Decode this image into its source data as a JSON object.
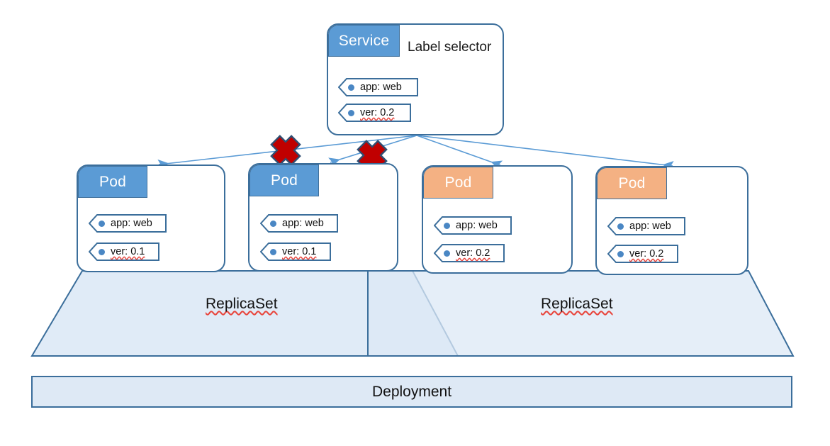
{
  "diagram": {
    "title": "Kubernetes Service label selector and ReplicaSet rollout diagram",
    "colors": {
      "blue_header": "#5B9BD5",
      "orange_header": "#F4B183",
      "border_blue": "#3B6E9B",
      "connector_blue": "#5B9BD5",
      "trapezoid_fill": "#DEE9F5",
      "deployment_fill": "#DEE9F5",
      "block_marker_red": "#C00000",
      "spellcheck_red": "#E8453C"
    }
  },
  "service": {
    "header_label": "Service",
    "side_text": "Label selector",
    "labels": [
      {
        "text": "app: web",
        "misspelled": false
      },
      {
        "text": "ver: 0.2",
        "misspelled": true
      }
    ]
  },
  "pods": [
    {
      "header_label": "Pod",
      "color": "blue",
      "labels": [
        {
          "text": "app: web",
          "misspelled": false
        },
        {
          "text": "ver: 0.1",
          "misspelled": true
        }
      ]
    },
    {
      "header_label": "Pod",
      "color": "blue",
      "labels": [
        {
          "text": "app: web",
          "misspelled": false
        },
        {
          "text": "ver: 0.1",
          "misspelled": true
        }
      ]
    },
    {
      "header_label": "Pod",
      "color": "orange",
      "labels": [
        {
          "text": "app: web",
          "misspelled": false
        },
        {
          "text": "ver: 0.2",
          "misspelled": true
        }
      ]
    },
    {
      "header_label": "Pod",
      "color": "orange",
      "labels": [
        {
          "text": "app: web",
          "misspelled": false
        },
        {
          "text": "ver: 0.2",
          "misspelled": true
        }
      ]
    }
  ],
  "replicasets": [
    {
      "label": "ReplicaSet",
      "misspelled": true
    },
    {
      "label": "ReplicaSet",
      "misspelled": true
    }
  ],
  "deployment": {
    "label": "Deployment"
  },
  "connectors": [
    {
      "name": "service-to-pod-1",
      "blocked": true
    },
    {
      "name": "service-to-pod-2",
      "blocked": true
    },
    {
      "name": "service-to-pod-3",
      "blocked": false
    },
    {
      "name": "service-to-pod-4",
      "blocked": false
    }
  ],
  "block_markers": [
    {
      "name": "blocked-connection-marker-1"
    },
    {
      "name": "blocked-connection-marker-2"
    }
  ]
}
